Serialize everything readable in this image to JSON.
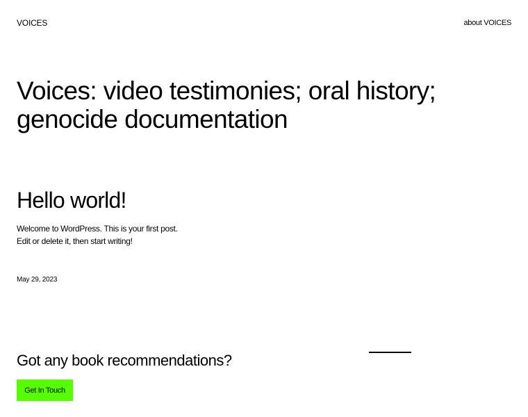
{
  "header": {
    "site_title": "VOICES",
    "nav_link": "about VOICES"
  },
  "hero": {
    "title": "Voices: video testimonies; oral history; genocide documentation"
  },
  "post": {
    "title": "Hello world!",
    "excerpt_line1": "Welcome to WordPress. This is your first post.",
    "excerpt_line2": "Edit or delete it, then start writing!",
    "date": "May 29, 2023"
  },
  "footer_cta": {
    "heading": "Got any book recommendations?",
    "button_label": "Get In Touch",
    "button_color": "#55ff00"
  }
}
